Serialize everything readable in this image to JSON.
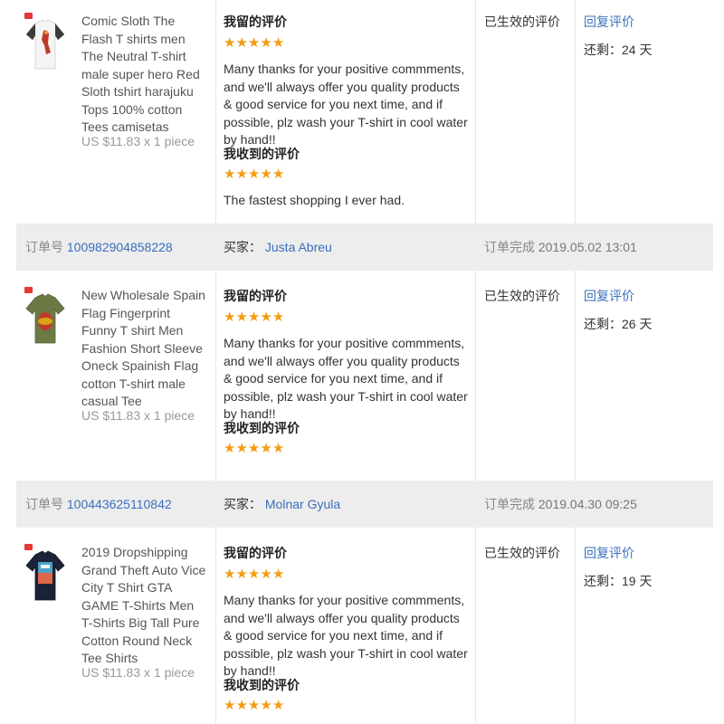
{
  "orders": [
    {
      "header": null,
      "product": {
        "title": "Comic Sloth The Flash T shirts men The Neutral T-shirt male super hero Red Sloth tshirt harajuku Tops 100% cotton Tees camisetas",
        "price": "US $11.83 x 1 piece",
        "shirt_color": "#f4f4f4",
        "sleeve_color": "#3a3a3a",
        "print_color": "#c0392b"
      },
      "my_review_label": "我留的评价",
      "my_review_stars": 5,
      "my_review_text": "Many thanks for your positive commments, and we'll always offer you quality products & good service for you next time, and if possible, plz wash your T-shirt in cool water by hand!!",
      "received_label": "我收到的评价",
      "received_stars": 5,
      "received_text": "The fastest shopping I ever had.",
      "status": "已生效的评价",
      "reply_label": "回复评价",
      "remaining": "还剩：24 天"
    },
    {
      "header": {
        "order_label": "订单号",
        "order_no": "100982904858228",
        "buyer_label": "买家：",
        "buyer_name": "Justa Abreu",
        "done_label": "订单完成",
        "done_time": "2019.05.02 13:01"
      },
      "product": {
        "title": "New Wholesale Spain Flag Fingerprint Funny T shirt Men Fashion Short Sleeve Oneck Spainish Flag cotton T-shirt male casual Tee",
        "price": "US $11.83 x 1 piece",
        "shirt_color": "#6b7a45",
        "sleeve_color": "#6b7a45",
        "print_color": "#d9a514"
      },
      "my_review_label": "我留的评价",
      "my_review_stars": 5,
      "my_review_text": "Many thanks for your positive commments, and we'll always offer you quality products & good service for you next time, and if possible, plz wash your T-shirt in cool water by hand!!",
      "received_label": "我收到的评价",
      "received_stars": 5,
      "received_text": "",
      "status": "已生效的评价",
      "reply_label": "回复评价",
      "remaining": "还剩：26 天"
    },
    {
      "header": {
        "order_label": "订单号",
        "order_no": "100443625110842",
        "buyer_label": "买家：",
        "buyer_name": "Molnar Gyula",
        "done_label": "订单完成",
        "done_time": "2019.04.30 09:25"
      },
      "product": {
        "title": "2019 Dropshipping Grand Theft Auto Vice City T Shirt GTA GAME T-Shirts Men T-Shirts Big Tall Pure Cotton Round Neck Tee Shirts",
        "price": "US $11.83 x 1 piece",
        "shirt_color": "#1b2436",
        "sleeve_color": "#1b2436",
        "print_color": "#4aa3c8"
      },
      "my_review_label": "我留的评价",
      "my_review_stars": 5,
      "my_review_text": "Many thanks for your positive commments, and we'll always offer you quality products & good service for you next time, and if possible, plz wash your T-shirt in cool water by hand!!",
      "received_label": "我收到的评价",
      "received_stars": 5,
      "received_text": "",
      "status": "已生效的评价",
      "reply_label": "回复评价",
      "remaining": "还剩：19 天"
    }
  ],
  "colors": {
    "link": "#3a6fbf",
    "star": "#f39c12",
    "header_bg": "#ededed"
  },
  "icons": {
    "star": "star-icon",
    "brand": "brand-badge-icon"
  }
}
